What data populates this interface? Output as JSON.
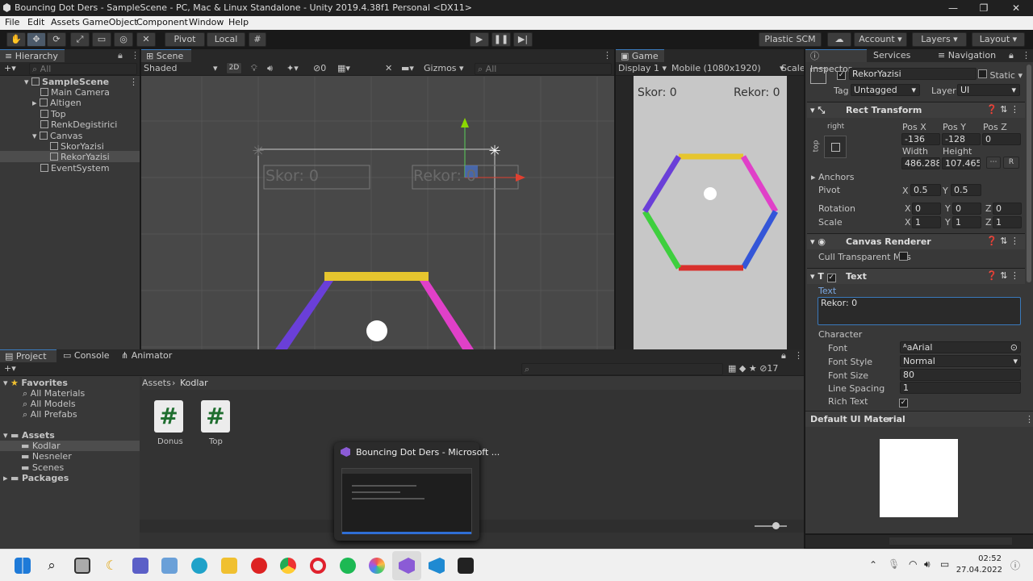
{
  "window": {
    "title": "Bouncing Dot Ders - SampleScene - PC, Mac & Linux Standalone - Unity 2019.4.38f1 Personal <DX11>",
    "min": "—",
    "max": "❐",
    "close": "✕"
  },
  "menu": [
    "File",
    "Edit",
    "Assets",
    "GameObject",
    "Component",
    "Window",
    "Help"
  ],
  "toolbar": {
    "pivot": "Pivot",
    "local": "Local",
    "plastic": "Plastic SCM",
    "account": "Account",
    "layers": "Layers",
    "layout": "Layout"
  },
  "hierarchy": {
    "tab": "Hierarchy",
    "search": "All",
    "scene": "SampleScene",
    "items": [
      "Main Camera",
      "Altigen",
      "Top",
      "RenkDegistirici",
      "Canvas",
      "SkorYazisi",
      "RekorYazisi",
      "EventSystem"
    ]
  },
  "scene": {
    "tab": "Scene",
    "shading": "Shaded",
    "mode2d": "2D",
    "hidden": "0",
    "gizmos": "Gizmos",
    "search": "All",
    "skor": "Skor: 0",
    "rekor": "Rekor: 0"
  },
  "game": {
    "tab": "Game",
    "display": "Display 1",
    "resolution": "Mobile (1080x1920)",
    "scale": "Scale",
    "skor": "Skor: 0",
    "rekor": "Rekor: 0"
  },
  "inspector": {
    "tabs": [
      "Inspector",
      "Services",
      "Navigation"
    ],
    "object": "RekorYazisi",
    "static": "Static",
    "tag_label": "Tag",
    "tag": "Untagged",
    "layer_label": "Layer",
    "layer": "UI",
    "rect": {
      "title": "Rect Transform",
      "anchor_h": "right",
      "anchor_v": "top",
      "posx_l": "Pos X",
      "posy_l": "Pos Y",
      "posz_l": "Pos Z",
      "posx": "-136",
      "posy": "-128",
      "posz": "0",
      "width_l": "Width",
      "height_l": "Height",
      "width": "486.2885",
      "height": "107.4655",
      "anchors": "Anchors",
      "pivot": "Pivot",
      "pivot_x": "0.5",
      "pivot_y": "0.5",
      "rotation": "Rotation",
      "rot_x": "0",
      "rot_y": "0",
      "rot_z": "0",
      "scale": "Scale",
      "sc_x": "1",
      "sc_y": "1",
      "sc_z": "1",
      "X": "X",
      "Y": "Y",
      "Z": "Z"
    },
    "canvas_renderer": {
      "title": "Canvas Renderer",
      "cull": "Cull Transparent Mes"
    },
    "text": {
      "title": "Text",
      "text_label": "Text",
      "value": "Rekor: 0",
      "character": "Character",
      "font_l": "Font",
      "font": "Arial",
      "style_l": "Font Style",
      "style": "Normal",
      "size_l": "Font Size",
      "size": "80",
      "spacing_l": "Line Spacing",
      "spacing": "1",
      "rich_l": "Rich Text"
    },
    "material": "Default UI Material"
  },
  "project": {
    "tabs": [
      "Project",
      "Console",
      "Animator"
    ],
    "favorites": "Favorites",
    "fav_items": [
      "All Materials",
      "All Models",
      "All Prefabs"
    ],
    "assets": "Assets",
    "asset_items": [
      "Kodlar",
      "Nesneler",
      "Scenes"
    ],
    "packages": "Packages",
    "breadcrumb_root": "Assets",
    "breadcrumb_cur": "Kodlar",
    "files": [
      "Donus",
      "Top"
    ],
    "hidden_count": "17"
  },
  "tooltip": {
    "title": "Bouncing Dot Ders - Microsoft ..."
  },
  "taskbar": {
    "time": "02:52",
    "date": "27.04.2022"
  },
  "colors": {
    "yellow": "#e6c52e",
    "magenta": "#e040c8",
    "purple": "#6a3fd8",
    "green": "#3ecf3e",
    "red": "#d8302c",
    "blue": "#3456d8"
  }
}
